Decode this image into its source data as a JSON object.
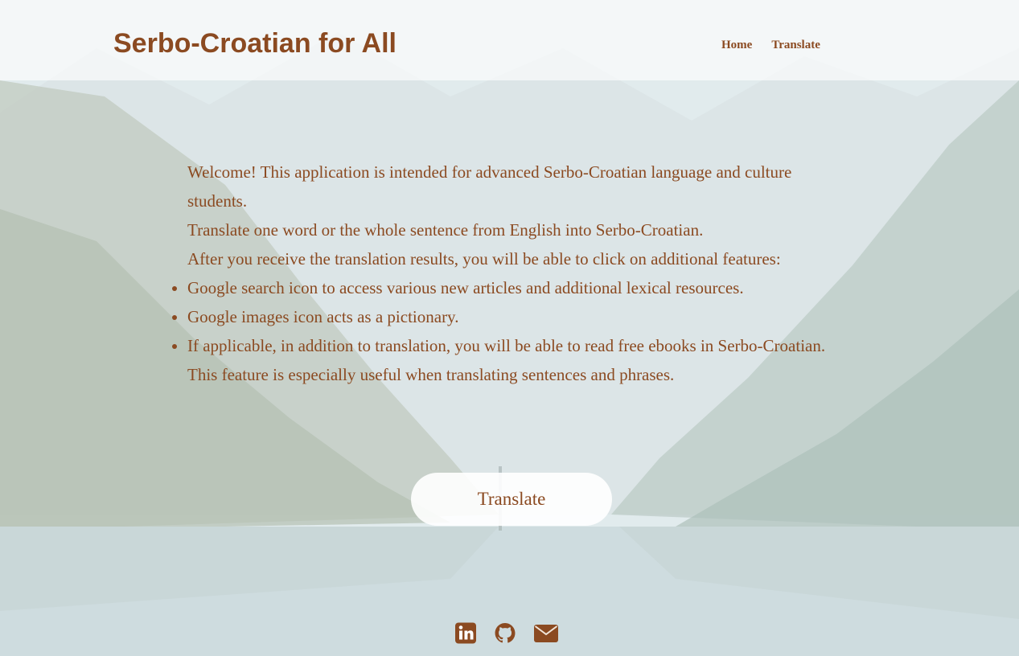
{
  "colors": {
    "brand": "#8b4a21",
    "header_bg": "rgba(255,255,255,0.62)",
    "button_bg": "#ffffff"
  },
  "header": {
    "title": "Serbo-Croatian for All",
    "nav": [
      {
        "label": "Home"
      },
      {
        "label": "Translate"
      }
    ]
  },
  "intro": {
    "lines": [
      "Welcome! This application is intended for advanced Serbo-Croatian language and culture students.",
      "Translate one word or the whole sentence from English into Serbo-Croatian.",
      "After you receive the translation results, you will be able to click on additional features:"
    ],
    "bullets": [
      "Google search icon to access various new articles and additional lexical resources.",
      "Google images icon acts as a pictionary.",
      "If applicable, in addition to translation, you will be able to read free ebooks in Serbo-Croatian."
    ],
    "footer_line": "This feature is especially useful when translating sentences and phrases."
  },
  "cta": {
    "label": "Translate"
  },
  "social": [
    {
      "icon": "linkedin-icon"
    },
    {
      "icon": "github-icon"
    },
    {
      "icon": "email-icon"
    }
  ]
}
